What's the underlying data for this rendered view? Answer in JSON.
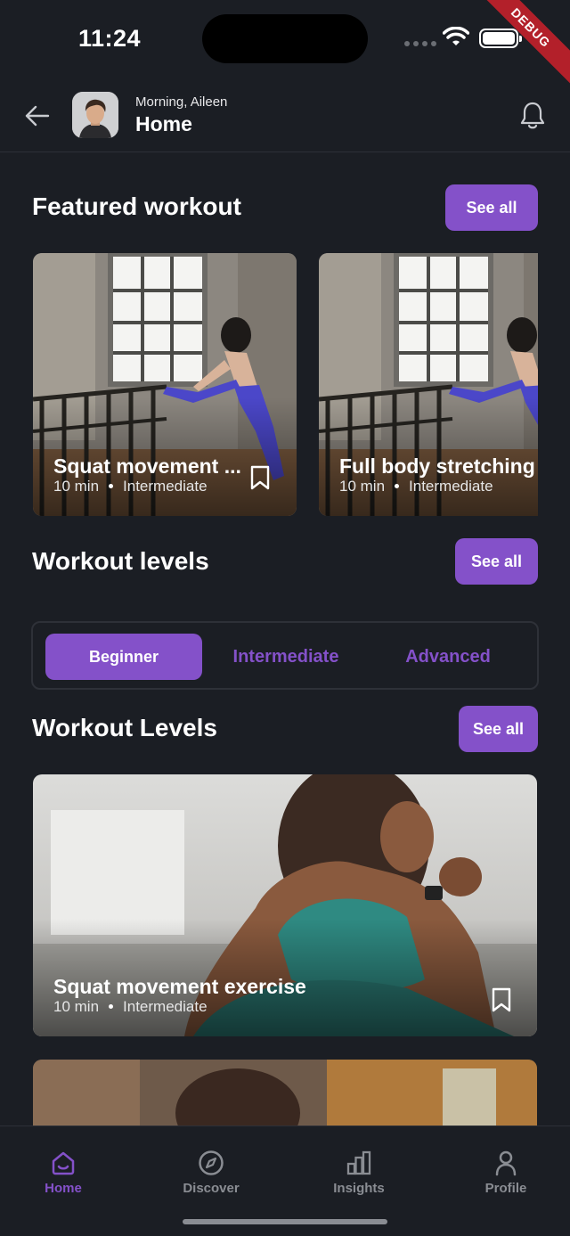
{
  "status_bar": {
    "time": "11:24",
    "debug_label": "DEBUG"
  },
  "header": {
    "greeting": "Morning, Aileen",
    "title": "Home",
    "back_icon": "arrow-left-icon",
    "notification_icon": "bell-icon"
  },
  "featured": {
    "title": "Featured workout",
    "see_all": "See all",
    "cards": [
      {
        "title": "Squat movement ...",
        "duration": "10 min",
        "level": "Intermediate"
      },
      {
        "title": "Full body stretching",
        "duration": "10 min",
        "level": "Intermediate"
      }
    ]
  },
  "levels": {
    "title": "Workout levels",
    "see_all": "See all",
    "tabs": [
      {
        "label": "Beginner",
        "selected": true
      },
      {
        "label": "Intermediate",
        "selected": false
      },
      {
        "label": "Advanced",
        "selected": false
      }
    ]
  },
  "levels_list": {
    "title": "Workout Levels",
    "see_all": "See all",
    "cards": [
      {
        "title": "Squat movement exercise",
        "duration": "10 min",
        "level": "Intermediate"
      }
    ]
  },
  "bottom_nav": {
    "items": [
      {
        "label": "Home",
        "icon": "home-icon",
        "active": true
      },
      {
        "label": "Discover",
        "icon": "compass-icon",
        "active": false
      },
      {
        "label": "Insights",
        "icon": "bar-chart-icon",
        "active": false
      },
      {
        "label": "Profile",
        "icon": "person-icon",
        "active": false
      }
    ]
  },
  "colors": {
    "accent": "#8451c9",
    "background": "#1b1e24",
    "muted": "#8a8d93"
  }
}
